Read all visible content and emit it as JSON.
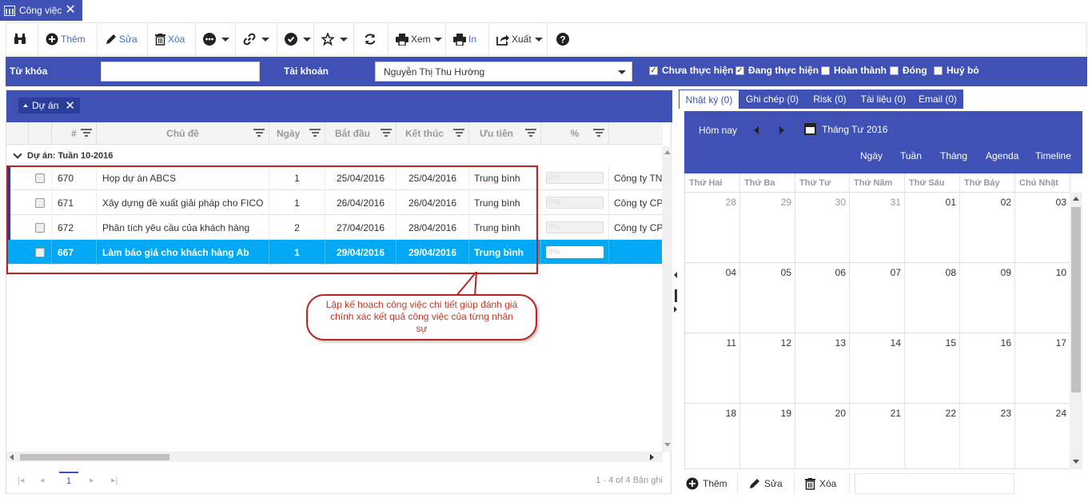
{
  "tab": {
    "title": "Công việc"
  },
  "toolbar": {
    "add": "Thêm",
    "edit": "Sửa",
    "delete": "Xóa",
    "view": "Xem",
    "print": "In",
    "export": "Xuất"
  },
  "filter": {
    "keyword_label": "Từ khóa",
    "keyword_value": "",
    "account_label": "Tài khoản",
    "account_value": "Nguyễn Thị Thu Hường",
    "statuses": [
      {
        "label": "Chưa thực hiện",
        "checked": true
      },
      {
        "label": "Đang thực hiện",
        "checked": true
      },
      {
        "label": "Hoàn thành",
        "checked": false
      },
      {
        "label": "Đóng",
        "checked": false
      },
      {
        "label": "Huỷ bỏ",
        "checked": false
      }
    ]
  },
  "grid": {
    "group_chip": "Dự án",
    "columns": [
      "#",
      "Chủ đề",
      "Ngày",
      "Bắt đầu",
      "Kết thúc",
      "Ưu tiên",
      "%"
    ],
    "group_row": "Dự án: Tuần 10-2016",
    "rows": [
      {
        "id": "670",
        "subject": "Họp dự án ABCS",
        "days": "1",
        "start": "25/04/2016",
        "end": "25/04/2016",
        "priority": "Trung bình",
        "pct": "0%",
        "company": "Công ty TN",
        "selected": false
      },
      {
        "id": "671",
        "subject": "Xây dựng đề xuất giải pháp cho FICO",
        "days": "1",
        "start": "26/04/2016",
        "end": "26/04/2016",
        "priority": "Trung bình",
        "pct": "0%",
        "company": "Công ty CP",
        "selected": false
      },
      {
        "id": "672",
        "subject": "Phân tích yêu cầu của khách hàng",
        "days": "2",
        "start": "27/04/2016",
        "end": "28/04/2016",
        "priority": "Trung bình",
        "pct": "0%",
        "company": "Công ty CP",
        "selected": false
      },
      {
        "id": "667",
        "subject": "Làm báo giá cho khách hàng Ab",
        "days": "1",
        "start": "29/04/2016",
        "end": "29/04/2016",
        "priority": "Trung bình",
        "pct": "0%",
        "company": "",
        "selected": true
      }
    ],
    "page": "1",
    "page_info": "1 - 4 of 4 Bản ghi"
  },
  "callout": {
    "text": "Lập kế hoạch công việc chi tiết giúp đánh giá chính xác kết quả công việc của từng nhân sự"
  },
  "right_tabs": [
    "Nhật ký (0)",
    "Ghi chép (0)",
    "Risk (0)",
    "Tài liệu (0)",
    "Email (0)"
  ],
  "calendar": {
    "today": "Hôm nay",
    "month": "Tháng Tư 2016",
    "views": [
      "Ngày",
      "Tuần",
      "Tháng",
      "Agenda",
      "Timeline"
    ],
    "weekdays": [
      "Thứ Hai",
      "Thứ Ba",
      "Thứ Tư",
      "Thứ Năm",
      "Thứ Sáu",
      "Thứ Bảy",
      "Chủ Nhật"
    ],
    "weeks": [
      [
        "28",
        "29",
        "30",
        "31",
        "01",
        "02",
        "03"
      ],
      [
        "04",
        "05",
        "06",
        "07",
        "08",
        "09",
        "10"
      ],
      [
        "11",
        "12",
        "13",
        "14",
        "15",
        "16",
        "17"
      ],
      [
        "18",
        "19",
        "20",
        "21",
        "22",
        "23",
        "24"
      ]
    ]
  },
  "right_footer": {
    "add": "Thêm",
    "edit": "Sửa",
    "delete": "Xóa"
  },
  "colors": {
    "primary": "#3f51b5",
    "selected_row": "#03a9f4",
    "callout_border": "#b22222"
  }
}
